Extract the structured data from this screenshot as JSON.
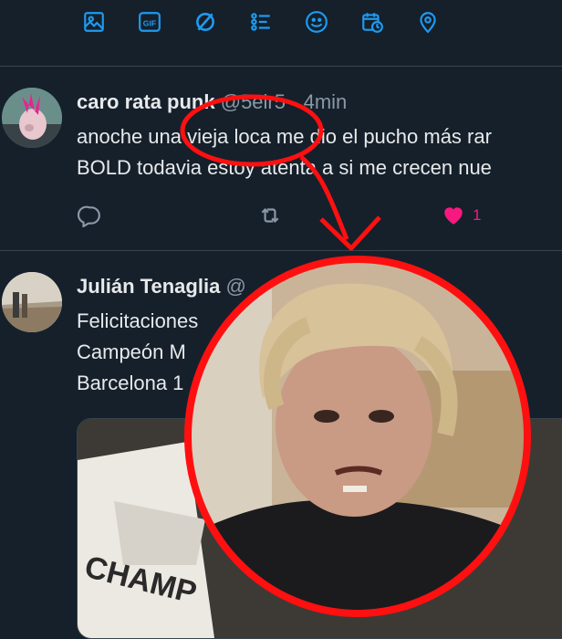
{
  "toolbar": {
    "icons": [
      "image-icon",
      "gif-icon",
      "poll-icon",
      "list-icon",
      "emoji-icon",
      "schedule-icon",
      "location-icon"
    ],
    "gif_label": "GIF",
    "accent": "#1d9bf0"
  },
  "tweet1": {
    "name": "caro rata punk",
    "handle": "@5elr5",
    "dot": "·",
    "time": "4min",
    "line1": "anoche una vieja loca me dio el pucho más rar",
    "line2": "BOLD todavia estoy atenta a si me crecen nue",
    "like_count": "1",
    "like_color": "#f91880"
  },
  "tweet2": {
    "name": "Julián Tenaglia",
    "handle": "@",
    "line1": "Felicitaciones",
    "line2": "Campeón M",
    "line3": "Barcelona 1",
    "media_text": "CHAMP"
  },
  "annotation": {
    "color": "#ff1010"
  }
}
